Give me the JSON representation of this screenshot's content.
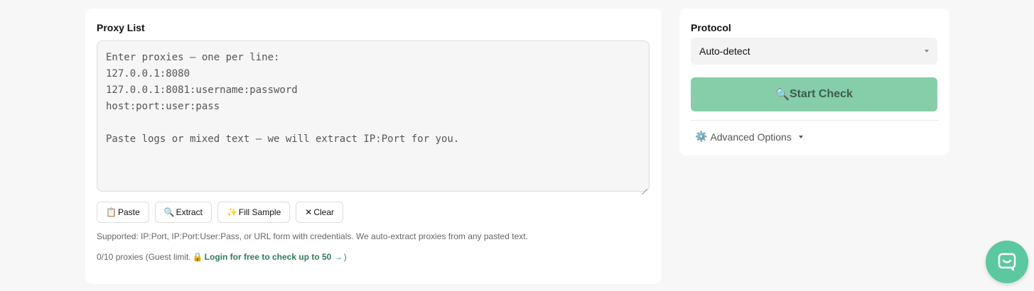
{
  "proxy_list": {
    "label": "Proxy List",
    "placeholder": "Enter proxies — one per line:\n127.0.0.1:8080\n127.0.0.1:8081:username:password\nhost:port:user:pass\n\nPaste logs or mixed text — we will extract IP:Port for you.",
    "buttons": [
      {
        "icon": "📋",
        "label": "Paste"
      },
      {
        "icon": "🔍",
        "label": "Extract"
      },
      {
        "icon": "✨",
        "label": "Fill Sample"
      },
      {
        "icon": "✕",
        "label": "Clear"
      }
    ],
    "hint": "Supported: IP:Port, IP:Port:User:Pass, or URL form with credentials. We auto-extract proxies from any pasted text.",
    "limit_text": "0/10 proxies (Guest limit.",
    "lock_icon": "🔒",
    "login_link": "Login for free to check up to 50 →",
    "limit_close": ")"
  },
  "protocol": {
    "label": "Protocol",
    "selected": "Auto-detect",
    "start_icon": "🔍",
    "start_label": "Start Check",
    "advanced_icon": "⚙️",
    "advanced_label": "Advanced Options"
  },
  "colors": {
    "accent": "#86cdaa",
    "link": "#2e7d5b",
    "chat": "#5bc8a0"
  }
}
